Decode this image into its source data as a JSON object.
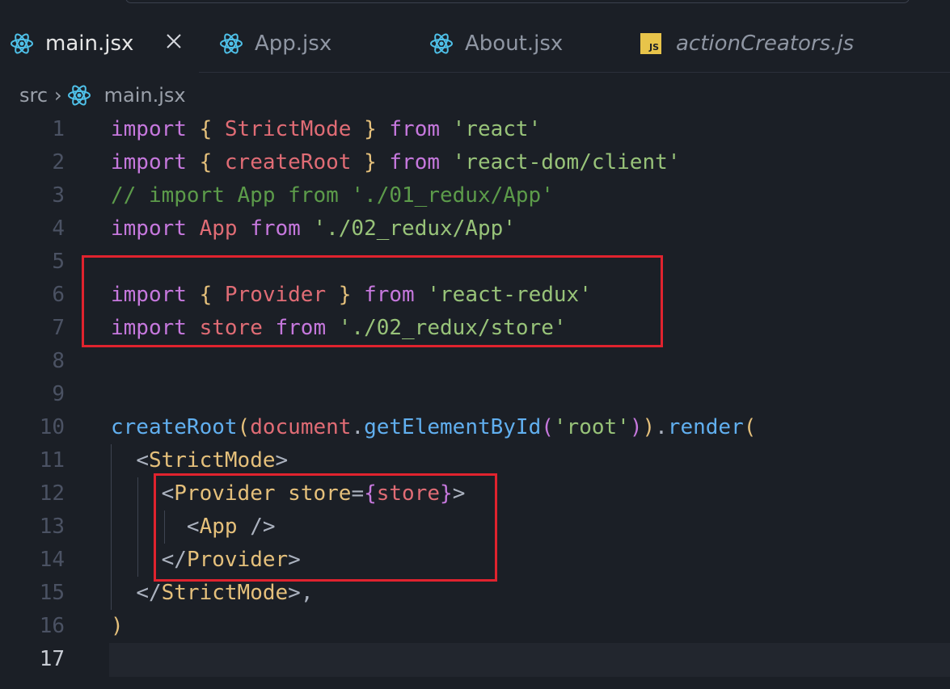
{
  "tabs": [
    {
      "label": "main.jsx",
      "icon": "react-icon",
      "active": true,
      "close": "✕"
    },
    {
      "label": "App.jsx",
      "icon": "react-icon",
      "active": false
    },
    {
      "label": "About.jsx",
      "icon": "react-icon",
      "active": false
    },
    {
      "label": "actionCreators.js",
      "icon": "js-icon",
      "active": false
    }
  ],
  "js_badge": "JS",
  "breadcrumb": {
    "folder": "src",
    "separator": "›",
    "file": "main.jsx"
  },
  "line_numbers": [
    "1",
    "2",
    "3",
    "4",
    "5",
    "6",
    "7",
    "8",
    "9",
    "10",
    "11",
    "12",
    "13",
    "14",
    "15",
    "16",
    "17"
  ],
  "code": {
    "l1": [
      [
        "import",
        "kw"
      ],
      [
        " ",
        ""
      ],
      [
        "{",
        "br1"
      ],
      [
        " StrictMode ",
        "var"
      ],
      [
        "}",
        "br1"
      ],
      [
        " from ",
        "kw"
      ],
      [
        "'react'",
        "str"
      ]
    ],
    "l2": [
      [
        "import",
        "kw"
      ],
      [
        " ",
        ""
      ],
      [
        "{",
        "br1"
      ],
      [
        " createRoot ",
        "var"
      ],
      [
        "}",
        "br1"
      ],
      [
        " from ",
        "kw"
      ],
      [
        "'react-dom/client'",
        "str"
      ]
    ],
    "l3": [
      [
        "// import App from './01_redux/App'",
        "cmt"
      ]
    ],
    "l4": [
      [
        "import",
        "kw"
      ],
      [
        " App",
        "var"
      ],
      [
        " from ",
        "kw"
      ],
      [
        "'./02_redux/App'",
        "str"
      ]
    ],
    "l5": [],
    "l6": [
      [
        "import",
        "kw"
      ],
      [
        " ",
        ""
      ],
      [
        "{",
        "br1"
      ],
      [
        " Provider ",
        "var"
      ],
      [
        "}",
        "br1"
      ],
      [
        " from ",
        "kw"
      ],
      [
        "'react-redux'",
        "str"
      ]
    ],
    "l7": [
      [
        "import",
        "kw"
      ],
      [
        " store",
        "var"
      ],
      [
        " from ",
        "kw"
      ],
      [
        "'./02_redux/store'",
        "str"
      ]
    ],
    "l8": [],
    "l9": [],
    "l10": [
      [
        "createRoot",
        "fn"
      ],
      [
        "(",
        "br1"
      ],
      [
        "document",
        "var"
      ],
      [
        ".",
        "punct"
      ],
      [
        "getElementById",
        "fn"
      ],
      [
        "(",
        "br2"
      ],
      [
        "'root'",
        "str"
      ],
      [
        ")",
        "br2"
      ],
      [
        ")",
        "br1"
      ],
      [
        ".",
        "punct"
      ],
      [
        "render",
        "fn"
      ],
      [
        "(",
        "br1"
      ]
    ],
    "l11": [
      [
        "  ",
        ""
      ],
      [
        "<",
        "punct"
      ],
      [
        "StrictMode",
        "tag"
      ],
      [
        ">",
        "punct"
      ]
    ],
    "l12": [
      [
        "    ",
        ""
      ],
      [
        "<",
        "punct"
      ],
      [
        "Provider",
        "tag"
      ],
      [
        " store",
        "attr"
      ],
      [
        "=",
        "punct"
      ],
      [
        "{",
        "br2"
      ],
      [
        "store",
        "var"
      ],
      [
        "}",
        "br2"
      ],
      [
        ">",
        "punct"
      ]
    ],
    "l13": [
      [
        "      ",
        ""
      ],
      [
        "<",
        "punct"
      ],
      [
        "App",
        "tag"
      ],
      [
        " />",
        "punct"
      ]
    ],
    "l14": [
      [
        "    ",
        ""
      ],
      [
        "</",
        "punct"
      ],
      [
        "Provider",
        "tag"
      ],
      [
        ">",
        "punct"
      ]
    ],
    "l15": [
      [
        "  ",
        ""
      ],
      [
        "</",
        "punct"
      ],
      [
        "StrictMode",
        "tag"
      ],
      [
        ">",
        "punct"
      ],
      [
        ",",
        "punct"
      ]
    ],
    "l16": [
      [
        ")",
        "br1"
      ]
    ],
    "l17": []
  },
  "colors": {
    "keyword": "#c678dd",
    "string": "#98c379",
    "variable": "#e06c75",
    "function": "#61afef",
    "tag": "#e5c07b",
    "comment": "#5c9b4a",
    "highlight_box": "#e0232e"
  }
}
